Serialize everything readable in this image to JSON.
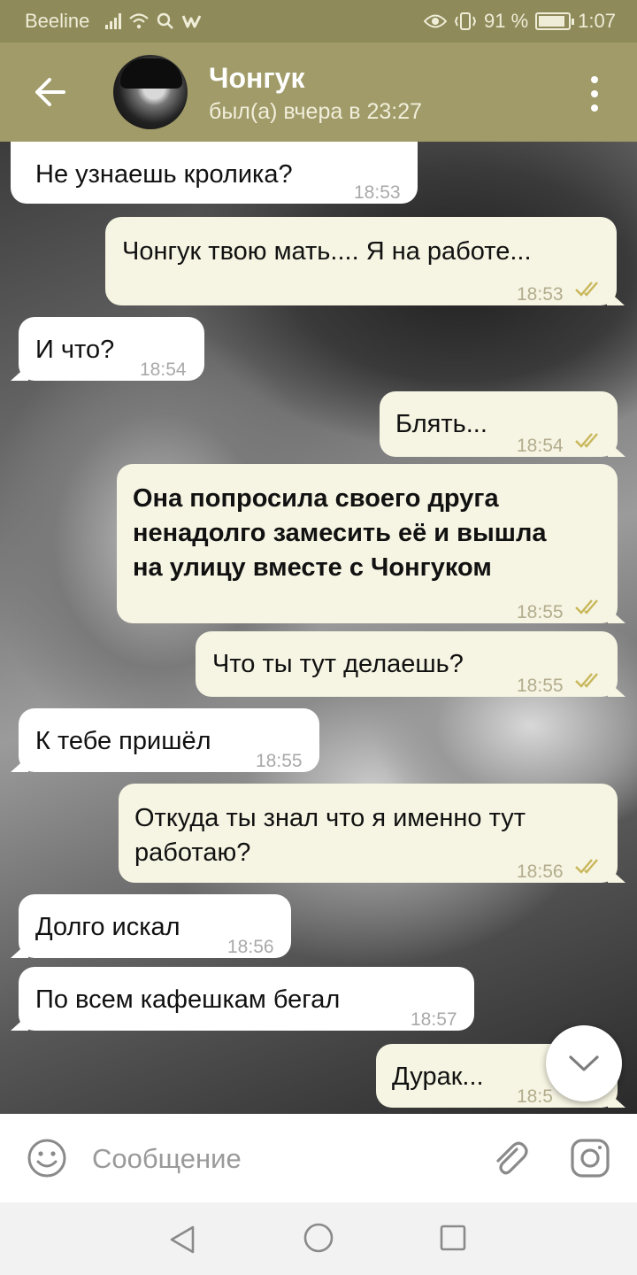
{
  "status_bar": {
    "carrier": "Beeline",
    "battery": "91 %",
    "battery_level": 0.91,
    "time": "1:07"
  },
  "header": {
    "contact_name": "Чонгук",
    "contact_status": "был(а) вчера в 23:27"
  },
  "messages": [
    {
      "dir": "in",
      "text": "Не узнаешь кролика?",
      "time": "18:53"
    },
    {
      "dir": "out",
      "text": "Чонгук твою мать.... Я на работе...",
      "time": "18:53"
    },
    {
      "dir": "in",
      "text": "И что?",
      "time": "18:54"
    },
    {
      "dir": "out",
      "text": "Блять...",
      "time": "18:54"
    },
    {
      "dir": "out",
      "text": "Она попросила своего друга ненадолго замесить её и вышла на улицу вместе с Чонгуком",
      "lines": [
        "Она попросила своего друга",
        "ненадолго замесить её и вышла",
        "на улицу вместе с Чонгуком"
      ],
      "bold": true,
      "time": "18:55"
    },
    {
      "dir": "out",
      "text": "Что ты тут делаешь?",
      "time": "18:55"
    },
    {
      "dir": "in",
      "text": "К тебе пришёл",
      "time": "18:55"
    },
    {
      "dir": "out",
      "text": "Откуда ты знал что я именно тут работаю?",
      "lines": [
        "Откуда ты знал что я именно тут",
        "работаю?"
      ],
      "time": "18:56"
    },
    {
      "dir": "in",
      "text": "Долго искал",
      "time": "18:56"
    },
    {
      "dir": "in",
      "text": "По всем кафешкам бегал",
      "time": "18:57"
    },
    {
      "dir": "out",
      "text": "Дурак...",
      "time": "18:5"
    }
  ],
  "input": {
    "placeholder": "Сообщение"
  },
  "colors": {
    "header": "#a09b68",
    "status_bar": "#8e8a5a",
    "outgoing_bubble": "#f6f4e2",
    "incoming_bubble": "#ffffff",
    "read_ticks": "#c8b75a"
  },
  "icons": [
    "back-arrow-icon",
    "more-vert-icon",
    "emoji-icon",
    "paperclip-icon",
    "camera-icon",
    "chevron-down-icon",
    "nav-back-icon",
    "nav-home-icon",
    "nav-recent-icon"
  ]
}
